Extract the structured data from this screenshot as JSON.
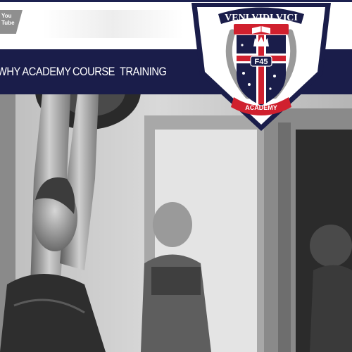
{
  "header": {
    "youtube_badge": {
      "line1": "You",
      "line2": "Tube"
    }
  },
  "nav": {
    "items": [
      {
        "label": "WHY ACADEMY"
      },
      {
        "label": "COURSE"
      },
      {
        "label": "TRAINING"
      }
    ]
  },
  "logo": {
    "motto": "VENI VIDI VICI",
    "monogram": "F45",
    "banner": "ACADEMY",
    "icons": [
      "book-icon",
      "crown-icon",
      "laurel-wreath-icon",
      "star-icon"
    ]
  },
  "hero": {
    "description_image": "grayscale-gym-photo"
  },
  "colors": {
    "navy": "#1a1d4a",
    "red": "#d0202e",
    "white": "#ffffff",
    "youtube_gray": "#8f8f8f"
  }
}
